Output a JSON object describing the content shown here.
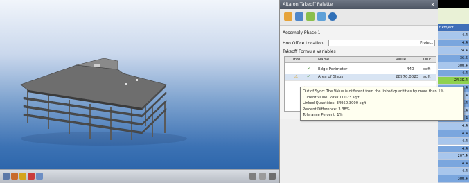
{
  "palette": {
    "title": "Aitalon Takeoff Palette",
    "close_icon": "close-icon",
    "tools": [
      "folder-icon",
      "globe-icon",
      "wand-icon",
      "settings-icon",
      "help-icon"
    ],
    "assembly": "Assembly Phase 1",
    "cost_location_label": "Hoo Office Location",
    "cost_location_value": "Project",
    "formula_label": "Takeoff Formula Variables",
    "columns": [
      "Info",
      "Name",
      "Value",
      "Unit"
    ],
    "rows": [
      {
        "name": "Edge Perimeter",
        "value": "440",
        "unit": "soft"
      },
      {
        "name": "Area of Slabs",
        "value": "28970.0023",
        "unit": "sqft"
      }
    ]
  },
  "tooltip": {
    "lines": [
      "Out of Sync: The Value is different from the linked quantities by more than 1%",
      "Current Value: 28970.0023 sqft",
      "Linked Quantities: 34950.3000 sqft",
      "Percent Difference: 3.38%",
      "Tolerance Percent: 1%"
    ]
  },
  "spreadsheet": {
    "header": "t Project",
    "values": [
      "4.4",
      "4.4",
      "24.4",
      "36.6",
      "300.4",
      "4.4",
      "24,3K.4",
      "4.4",
      "4.4",
      "4.4",
      "4.4",
      "4.4",
      "4.4",
      "4.4",
      "4.4",
      "4.4",
      "207.4",
      "4.4",
      "4.4",
      "300.4"
    ]
  },
  "viewport": {
    "bottom_icons": [
      "camera-icon",
      "pen-icon",
      "warning-icon",
      "eye-icon",
      "link-icon"
    ],
    "right_icons": [
      "window-icon",
      "back-icon",
      "zoom-icon"
    ]
  }
}
